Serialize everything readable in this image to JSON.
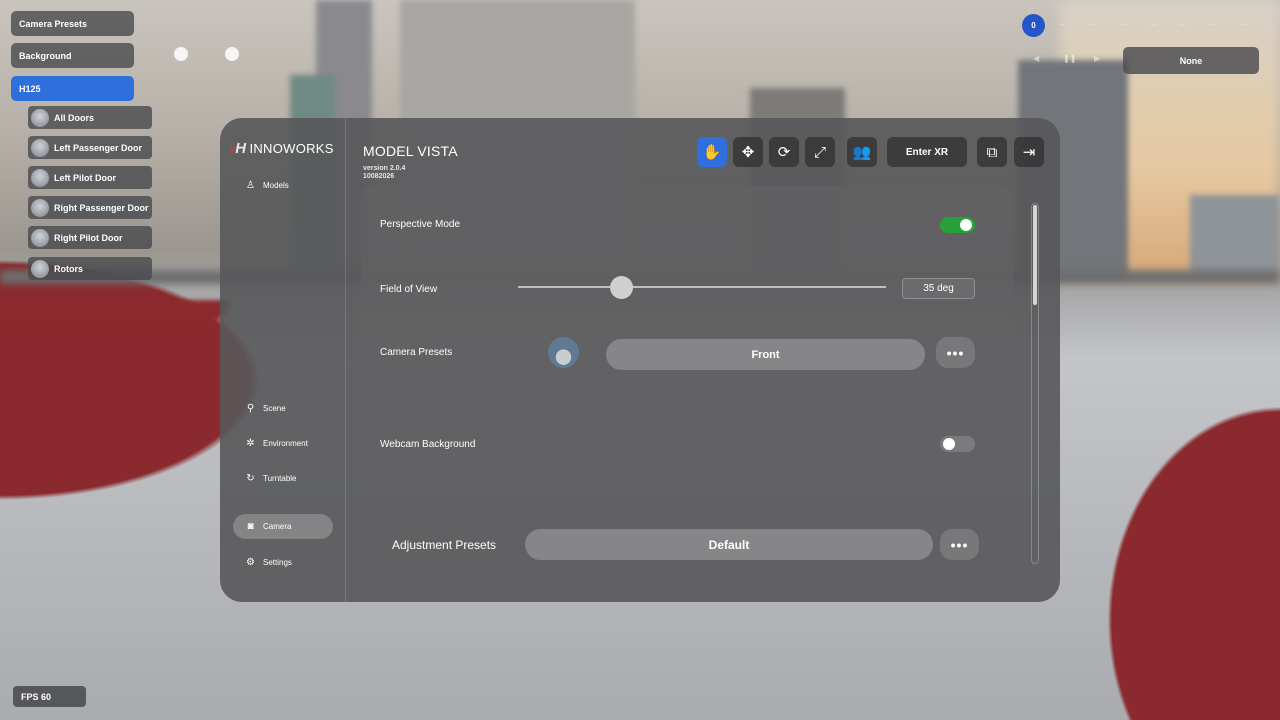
{
  "scene_tree": {
    "camera_presets": "Camera Presets",
    "background": "Background",
    "model": "H125",
    "children": [
      {
        "label": "All Doors"
      },
      {
        "label": "Left Passenger Door"
      },
      {
        "label": "Left Pilot Door"
      },
      {
        "label": "Right Passenger Door"
      },
      {
        "label": "Right Pilot Door"
      },
      {
        "label": "Rotors"
      }
    ]
  },
  "top_right": {
    "counter": "0",
    "selector_value": "None"
  },
  "fps": "FPS 60",
  "sidebar": {
    "brand": "INNOWORKS",
    "items": {
      "models": "Models",
      "scene": "Scene",
      "environment": "Environment",
      "turntable": "Turntable",
      "camera": "Camera",
      "settings": "Settings"
    },
    "active": "Camera"
  },
  "header": {
    "title": "MODEL VISTA",
    "version": "version 2.0.4",
    "build": "10082026",
    "enter_xr": "Enter XR"
  },
  "camera": {
    "perspective_mode_label": "Perspective Mode",
    "perspective_mode_on": true,
    "fov_label": "Field of View",
    "fov_value": "35 deg",
    "fov_slider_fraction": 0.28,
    "camera_presets_label": "Camera Presets",
    "camera_preset_value": "Front",
    "webcam_label": "Webcam Background",
    "webcam_on": false,
    "adjustment_presets_label": "Adjustment Presets",
    "adjustment_preset_value": "Default",
    "more": "•••"
  },
  "colors": {
    "accent_blue": "#2f6fdc",
    "toggle_on": "#29a03a"
  }
}
